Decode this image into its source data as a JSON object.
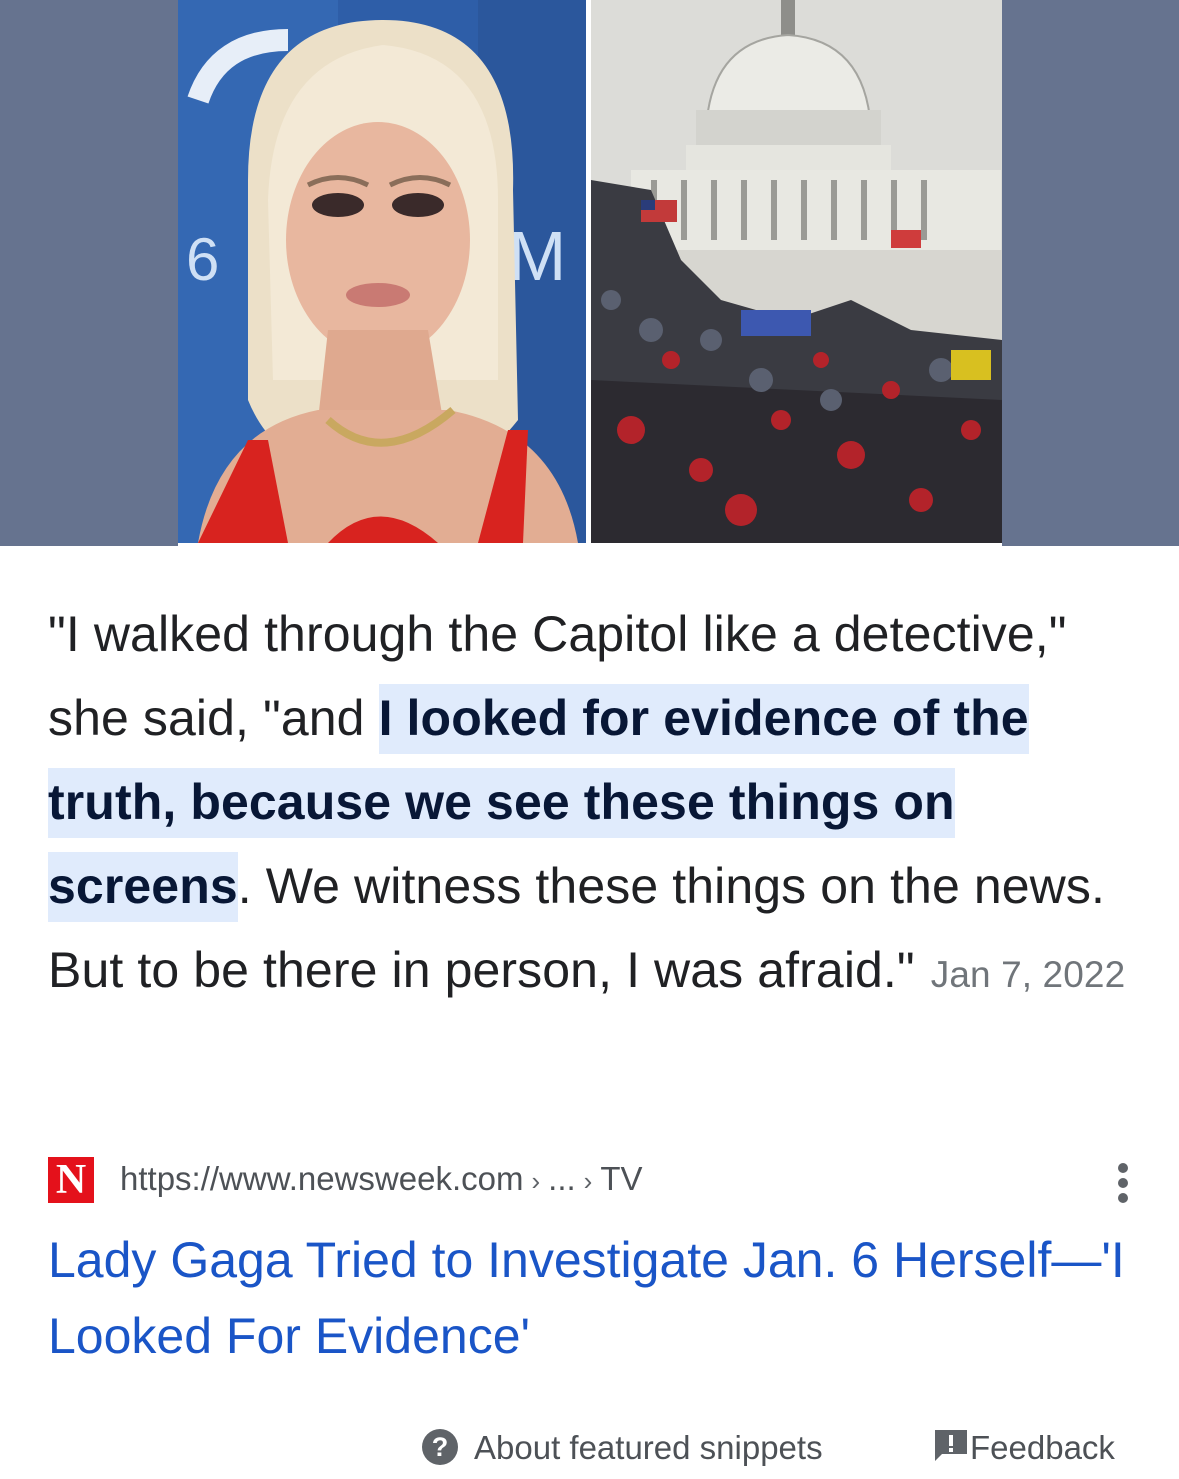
{
  "image": {
    "left_photo": "lady-gaga-portrait",
    "right_photo": "capitol-crowd-photo",
    "left_photo_bg_text": "6",
    "left_photo_bg_text_2": "M",
    "banner_color": "#66738f"
  },
  "snippet": {
    "text_before": "\"I walked through the Capitol like a detective,\" she said, \"and ",
    "highlight": "I looked for evidence of the truth, because we see these things on screens",
    "text_after": ". We witness these things on the news. But to be there in person, I was afraid.\"",
    "date": "Jan 7, 2022",
    "highlight_color": "#e0ebfc"
  },
  "source": {
    "favicon_letter": "N",
    "favicon_color": "#e4111b",
    "url_base": "https://www.newsweek.com",
    "breadcrumb_1": "...",
    "breadcrumb_2": "TV",
    "more_icon": "more-vertical-icon"
  },
  "result": {
    "title": "Lady Gaga Tried to Investigate Jan. 6 Herself—'I Looked For Evidence'",
    "link_color": "#1a55c7"
  },
  "footer": {
    "about_label": "About featured snippets",
    "about_icon": "help-circle-icon",
    "feedback_label": "Feedback",
    "feedback_icon": "feedback-icon"
  }
}
